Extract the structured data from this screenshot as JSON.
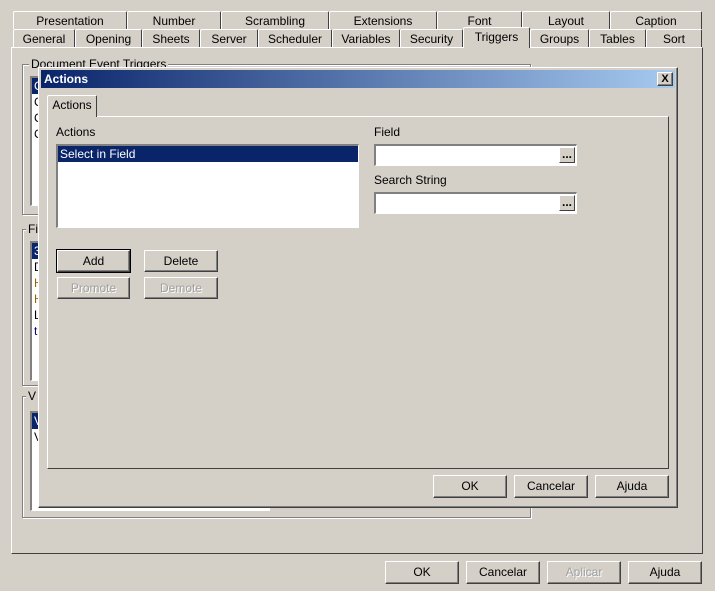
{
  "main": {
    "tabs_row1": [
      "Presentation",
      "Number",
      "Scrambling",
      "Extensions",
      "Font",
      "Layout",
      "Caption"
    ],
    "tabs_row2": [
      "General",
      "Opening",
      "Sheets",
      "Server",
      "Scheduler",
      "Variables",
      "Security",
      "Triggers",
      "Groups",
      "Tables",
      "Sort"
    ],
    "selected_tab": "Triggers",
    "groups": {
      "document_event_triggers": "Document Event Triggers",
      "field_group": "Fi",
      "variable_group": "V"
    },
    "doc_list": [
      "C",
      "C",
      "C",
      "C"
    ],
    "field_list": [
      "3",
      "D",
      "H",
      "H",
      "L",
      "t"
    ],
    "var_list": [
      "V",
      "V"
    ],
    "buttons": {
      "ok": "OK",
      "cancel": "Cancelar",
      "apply": "Aplicar",
      "help": "Ajuda"
    }
  },
  "dialog": {
    "title": "Actions",
    "close": "X",
    "tab": "Actions",
    "actions_label": "Actions",
    "actions": [
      "Select in Field"
    ],
    "field_label": "Field",
    "field_value": "",
    "search_label": "Search String",
    "search_value": "",
    "ellipsis": "...",
    "buttons": {
      "add": "Add",
      "delete": "Delete",
      "promote": "Promote",
      "demote": "Demote",
      "ok": "OK",
      "cancel": "Cancelar",
      "help": "Ajuda"
    }
  },
  "colors": {
    "selection": "#0a246a",
    "title_start": "#0a246a",
    "title_end": "#a6caf0",
    "face": "#d4d0c8"
  }
}
